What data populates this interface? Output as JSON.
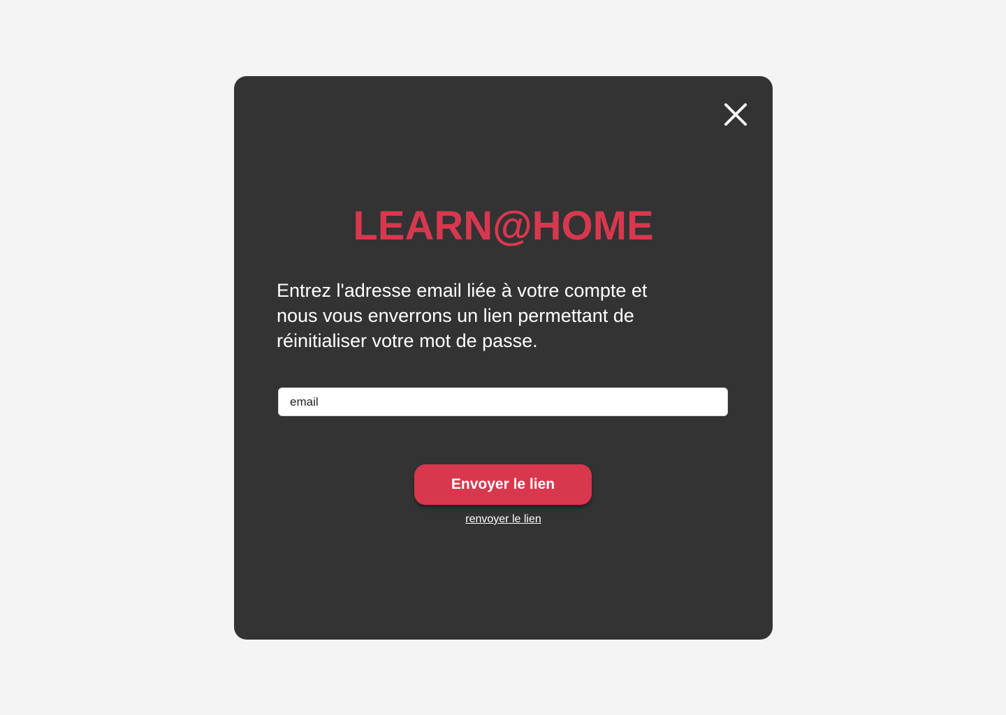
{
  "modal": {
    "brand": "LEARN@HOME",
    "description": "Entrez l'adresse email liée à votre compte et nous vous enverrons un lien permettant de réinitialiser votre mot de passe.",
    "email": {
      "placeholder": "email",
      "value": ""
    },
    "send_button_label": "Envoyer le lien",
    "resend_link_label": "renvoyer le lien",
    "close_icon": "close-icon"
  },
  "colors": {
    "background": "#f4f4f4",
    "modal": "#333333",
    "accent": "#d7384e",
    "text": "#ffffff"
  }
}
